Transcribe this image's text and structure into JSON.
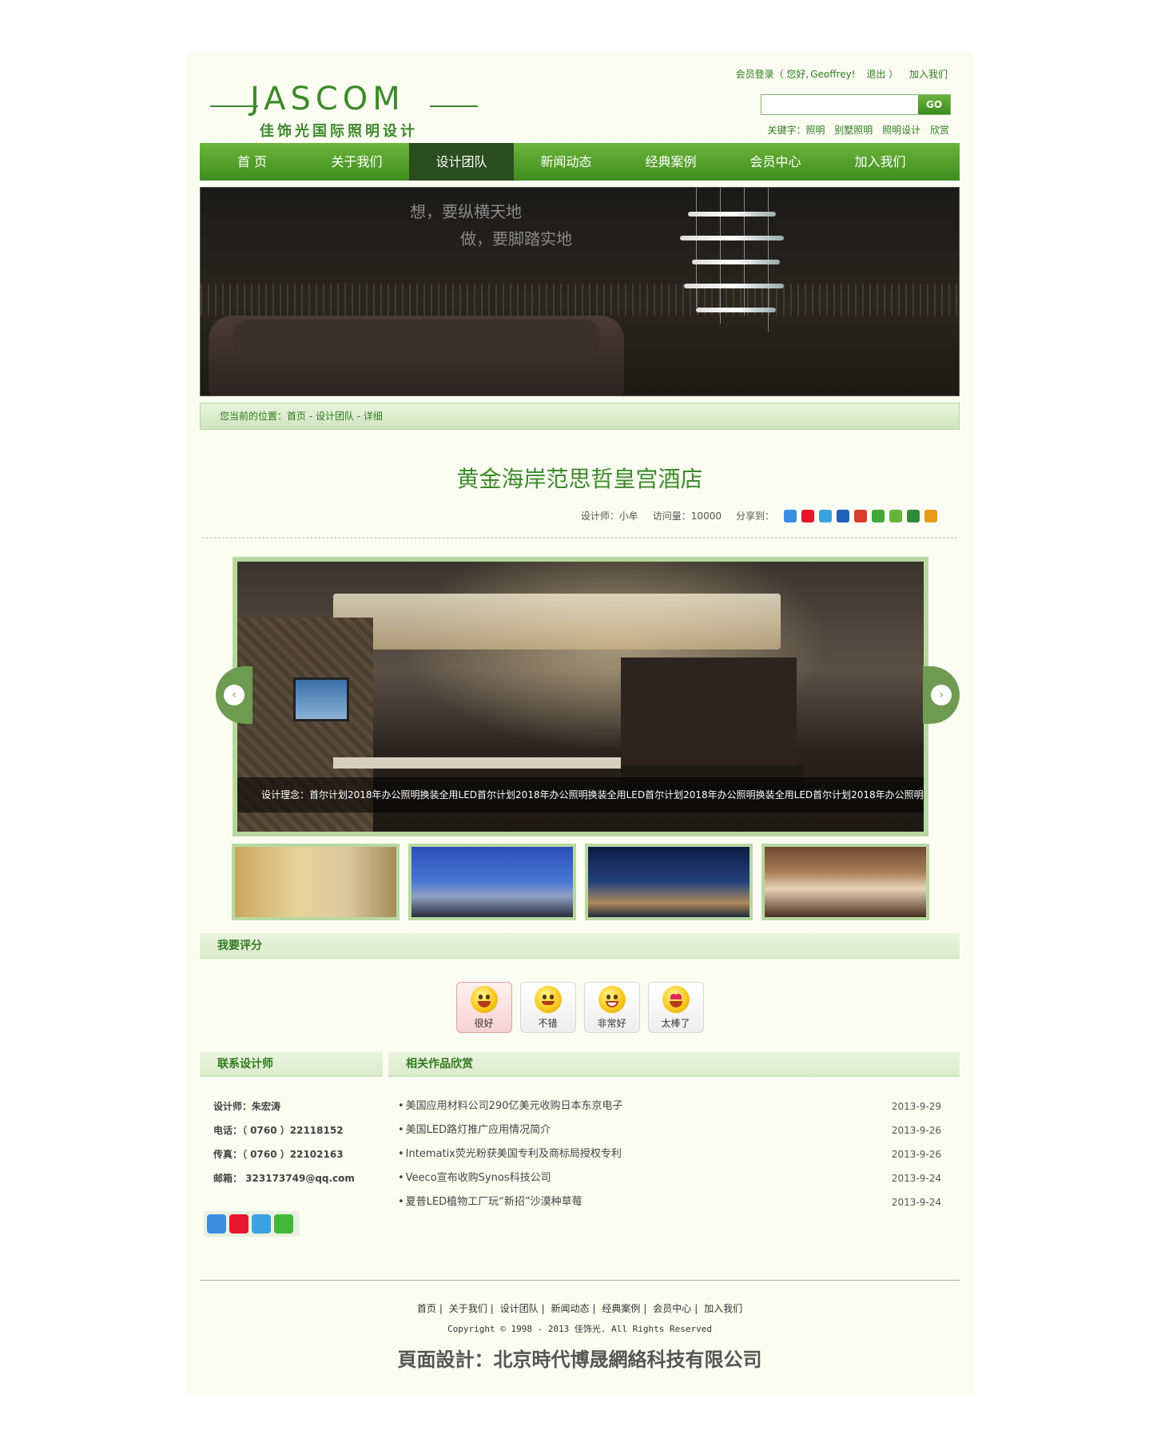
{
  "header": {
    "logo_text": "JASCOM",
    "logo_cn": "佳饰光国际照明设计",
    "member": {
      "login": "会员登录（ 您好,",
      "user": "Geoffrey!",
      "logout": "退出 ）",
      "join": "加入我们"
    },
    "search": {
      "placeholder": "",
      "button": "GO"
    },
    "keywords": {
      "label": "关键字：照明",
      "items": [
        "别墅照明",
        "照明设计",
        "欣赏"
      ]
    }
  },
  "nav": {
    "items": [
      {
        "label": "首 页"
      },
      {
        "label": "关于我们"
      },
      {
        "label": "设计团队"
      },
      {
        "label": "新闻动态"
      },
      {
        "label": "经典案例"
      },
      {
        "label": "会员中心"
      },
      {
        "label": "加入我们"
      }
    ],
    "active_index": 2
  },
  "banner": {
    "slogan1": "想，要纵横天地",
    "slogan2": "做，要脚踏实地"
  },
  "breadcrumb": "您当前的位置：首页 - 设计团队 - 详细",
  "article": {
    "title": "黄金海岸范思哲皇宫酒店",
    "designer": "设计师：小牟",
    "views": "访问量：10000",
    "share_label": "分享到："
  },
  "gallery": {
    "caption": "设计理念：首尔计划2018年办公照明换装全用LED首尔计划2018年办公照明换装全用LED首尔计划2018年办公照明换装全用LED首尔计划2018年办公照明",
    "prev": "‹",
    "next": "›"
  },
  "rating": {
    "heading": "我要评分",
    "options": [
      {
        "label": "很好"
      },
      {
        "label": "不错"
      },
      {
        "label": "非常好"
      },
      {
        "label": "太棒了"
      }
    ]
  },
  "contact": {
    "heading": "联系设计师",
    "designer": "设计师：朱宏涛",
    "phone": "电话：（ 0760 ）22118152",
    "fax": "传真：（ 0760 ）22102163",
    "email": "邮箱： 323173749@qq.com"
  },
  "related": {
    "heading": "相关作品欣赏",
    "items": [
      {
        "title": "美国应用材料公司290亿美元收购日本东京电子",
        "date": "2013-9-29"
      },
      {
        "title": "美国LED路灯推广应用情况简介",
        "date": "2013-9-26"
      },
      {
        "title": "Intematix荧光粉获美国专利及商标局授权专利",
        "date": "2013-9-26"
      },
      {
        "title": "Veeco宣布收购Synos科技公司",
        "date": "2013-9-24"
      },
      {
        "title": "夏普LED植物工厂玩“新招”沙漠种草莓",
        "date": "2013-9-24"
      }
    ]
  },
  "footer": {
    "links": [
      "首页",
      "关于我们",
      "设计团队",
      "新闻动态",
      "经典案例",
      "会员中心",
      "加入我们"
    ],
    "copyright": "Copyright © 1998 - 2013 佳饰光. All Rights Reserved",
    "credit": "頁面設計：北京時代博晟網絡科技有限公司"
  },
  "colors": {
    "brand_green": "#3d8a2a",
    "nav_active": "#2b4d1f",
    "frame_green": "#b7d8a0"
  }
}
